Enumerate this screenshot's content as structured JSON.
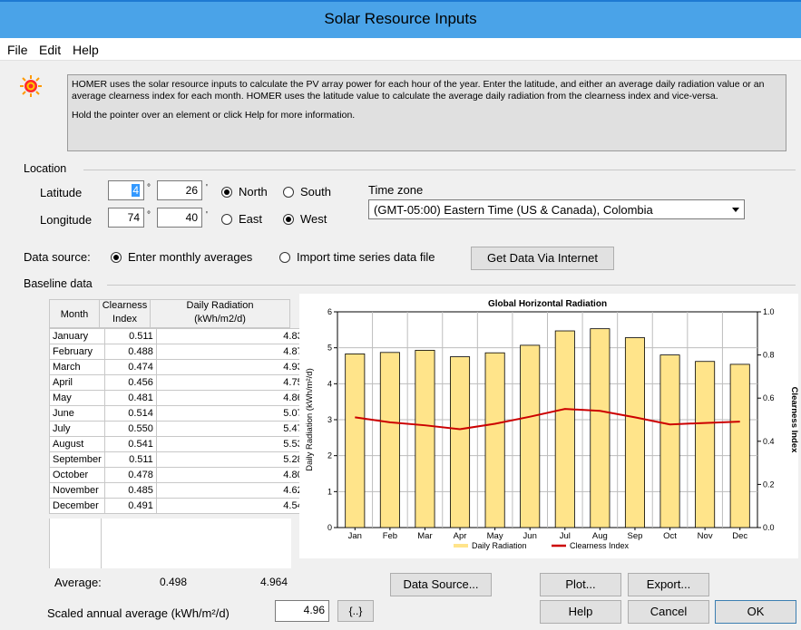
{
  "window": {
    "title": "Solar Resource Inputs"
  },
  "menu": [
    "File",
    "Edit",
    "Help"
  ],
  "info": {
    "line1": "HOMER uses the solar resource inputs to calculate the PV array power for each hour of the year. Enter the latitude, and either an average daily radiation value or an average clearness index for each month. HOMER uses the latitude value to calculate the average daily radiation from the clearness index and vice-versa.",
    "line2": "Hold the pointer over an element or click Help for more information.",
    "icon": "sun-icon"
  },
  "location": {
    "group": "Location",
    "lat_label": "Latitude",
    "lon_label": "Longitude",
    "lat_deg": "4",
    "lat_min": "26",
    "lon_deg": "74",
    "lon_min": "40",
    "deg_sym": "°",
    "min_sym": "'",
    "north": "North",
    "south": "South",
    "east": "East",
    "west": "West",
    "tz_label": "Time zone",
    "tz_value": "(GMT-05:00) Eastern Time (US & Canada), Colombia"
  },
  "source": {
    "label": "Data source:",
    "opt1": "Enter monthly averages",
    "opt2": "Import time series data file",
    "get_btn": "Get Data Via Internet"
  },
  "baseline": {
    "group": "Baseline data",
    "col_month": "Month",
    "col_clear1": "Clearness",
    "col_clear2": "Index",
    "col_rad1": "Daily Radiation",
    "col_rad2": "(kWh/m2/d)",
    "rows": [
      {
        "m": "January",
        "c": "0.511",
        "r": "4.830"
      },
      {
        "m": "February",
        "c": "0.488",
        "r": "4.870"
      },
      {
        "m": "March",
        "c": "0.474",
        "r": "4.930"
      },
      {
        "m": "April",
        "c": "0.456",
        "r": "4.750"
      },
      {
        "m": "May",
        "c": "0.481",
        "r": "4.860"
      },
      {
        "m": "June",
        "c": "0.514",
        "r": "5.070"
      },
      {
        "m": "July",
        "c": "0.550",
        "r": "5.470"
      },
      {
        "m": "August",
        "c": "0.541",
        "r": "5.530"
      },
      {
        "m": "September",
        "c": "0.511",
        "r": "5.280"
      },
      {
        "m": "October",
        "c": "0.478",
        "r": "4.800"
      },
      {
        "m": "November",
        "c": "0.485",
        "r": "4.620"
      },
      {
        "m": "December",
        "c": "0.491",
        "r": "4.540"
      }
    ],
    "avg_label": "Average:",
    "avg_clear": "0.498",
    "avg_rad": "4.964",
    "scaled_label": "Scaled annual average (kWh/m²/d)",
    "scaled_value": "4.96",
    "ellipsis_btn": "{..}"
  },
  "buttons": {
    "data_source": "Data Source...",
    "plot": "Plot...",
    "export": "Export...",
    "help": "Help",
    "cancel": "Cancel",
    "ok": "OK"
  },
  "colors": {
    "bar": "#ffe48a",
    "line": "#cc0000",
    "title_bar": "#4aa3e8"
  },
  "chart_data": {
    "type": "bar",
    "title": "Global Horizontal Radiation",
    "ylabel": "Daily Radiation (kWh/m²/d)",
    "y2label": "Clearness Index",
    "categories": [
      "Jan",
      "Feb",
      "Mar",
      "Apr",
      "May",
      "Jun",
      "Jul",
      "Aug",
      "Sep",
      "Oct",
      "Nov",
      "Dec"
    ],
    "series": [
      {
        "name": "Daily Radiation",
        "type": "bar",
        "values": [
          4.83,
          4.87,
          4.93,
          4.75,
          4.86,
          5.07,
          5.47,
          5.53,
          5.28,
          4.8,
          4.62,
          4.54
        ]
      },
      {
        "name": "Clearness Index",
        "type": "line",
        "axis": "right",
        "values": [
          0.511,
          0.488,
          0.474,
          0.456,
          0.481,
          0.514,
          0.55,
          0.541,
          0.511,
          0.478,
          0.485,
          0.491
        ]
      }
    ],
    "ylim": [
      0,
      6
    ],
    "y2lim": [
      0,
      1.0
    ],
    "yticks": [
      "0",
      "1",
      "2",
      "3",
      "4",
      "5",
      "6"
    ],
    "y2ticks": [
      "0.0",
      "0.2",
      "0.4",
      "0.6",
      "0.8",
      "1.0"
    ],
    "grid": true,
    "legend": "bottom"
  }
}
